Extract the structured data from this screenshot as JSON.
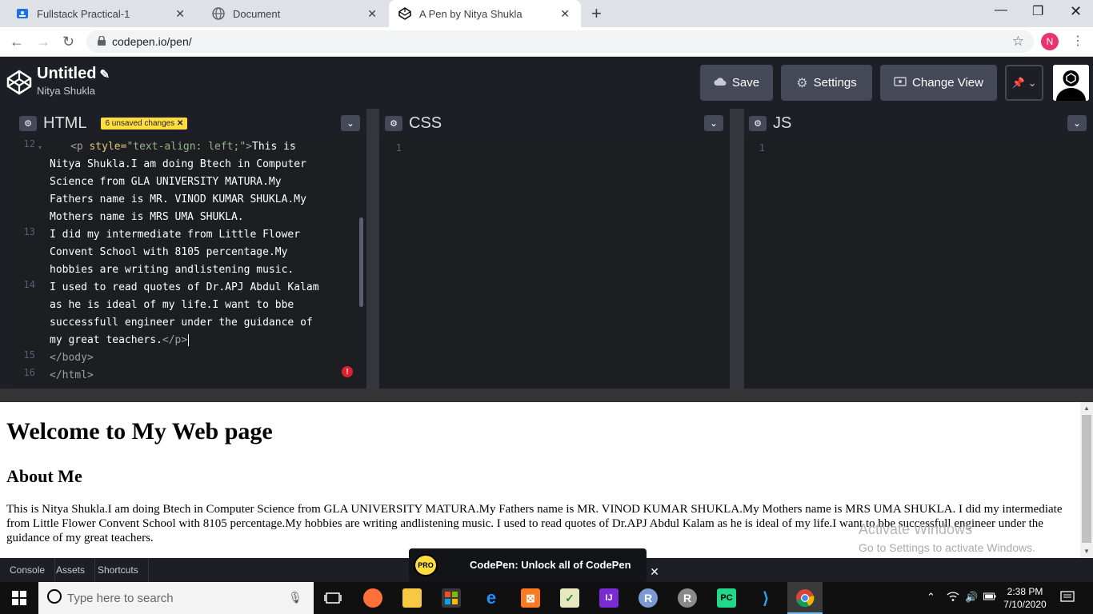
{
  "browser": {
    "tabs": [
      {
        "label": "Fullstack Practical-1",
        "icon": "classroom-icon"
      },
      {
        "label": "Document",
        "icon": "globe-icon"
      },
      {
        "label": "A Pen by Nitya Shukla",
        "icon": "codepen-icon",
        "active": true
      }
    ],
    "url": "codepen.io/pen/",
    "profile_initial": "N"
  },
  "codepen": {
    "pen_title": "Untitled",
    "author": "Nitya Shukla",
    "save_label": "Save",
    "settings_label": "Settings",
    "change_view_label": "Change View"
  },
  "editors": {
    "html": {
      "label": "HTML",
      "badge": "6 unsaved changes",
      "lines": [
        {
          "no": "12",
          "tag_open": "<p ",
          "attr": "style=",
          "str": "\"text-align: left;\"",
          "tag_close": ">",
          "text": "This is"
        },
        {
          "no": "",
          "text": "Nitya Shukla.I am doing Btech in Computer"
        },
        {
          "no": "",
          "text": "Science from GLA UNIVERSITY MATURA.My"
        },
        {
          "no": "",
          "text": "Fathers name is MR. VINOD KUMAR SHUKLA.My"
        },
        {
          "no": "",
          "text": "Mothers name is MRS UMA SHUKLA."
        },
        {
          "no": "13",
          "text": "I did my intermediate from Little Flower"
        },
        {
          "no": "",
          "text": "Convent School with 8105 percentage.My"
        },
        {
          "no": "",
          "text": "hobbies are writing andlistening music."
        },
        {
          "no": "14",
          "text": "I used to read quotes of Dr.APJ Abdul Kalam"
        },
        {
          "no": "",
          "text": "as he is ideal of my life.I want to bbe"
        },
        {
          "no": "",
          "text": "successfull engineer under the guidance of"
        },
        {
          "no": "",
          "text": "my great teachers.",
          "end_tag": "</p>"
        },
        {
          "no": "15",
          "tag_only": "</body>"
        },
        {
          "no": "16",
          "tag_only": "</html>"
        }
      ]
    },
    "css": {
      "label": "CSS",
      "line_no": "1"
    },
    "js": {
      "label": "JS",
      "line_no": "1"
    }
  },
  "preview": {
    "heading": "Welcome to My Web page",
    "subheading": "About Me",
    "paragraph": "This is Nitya Shukla.I am doing Btech in Computer Science from GLA UNIVERSITY MATURA.My Fathers name is MR. VINOD KUMAR SHUKLA.My Mothers name is MRS UMA SHUKLA. I did my intermediate from Little Flower Convent School with 8105 percentage.My hobbies are writing andlistening music. I used to read quotes of Dr.APJ Abdul Kalam as he is ideal of my life.I want to bbe successfull engineer under the guidance of my great teachers.",
    "watermark_title": "Activate Windows",
    "watermark_sub": "Go to Settings to activate Windows."
  },
  "footer": {
    "console_label": "Console",
    "assets_label": "Assets",
    "shortcuts_label": "Shortcuts",
    "promo_badge": "PRO",
    "promo_text": "CodePen: Unlock all of CodePen"
  },
  "taskbar": {
    "search_placeholder": "Type here to search",
    "time": "2:38 PM",
    "date": "7/10/2020"
  }
}
